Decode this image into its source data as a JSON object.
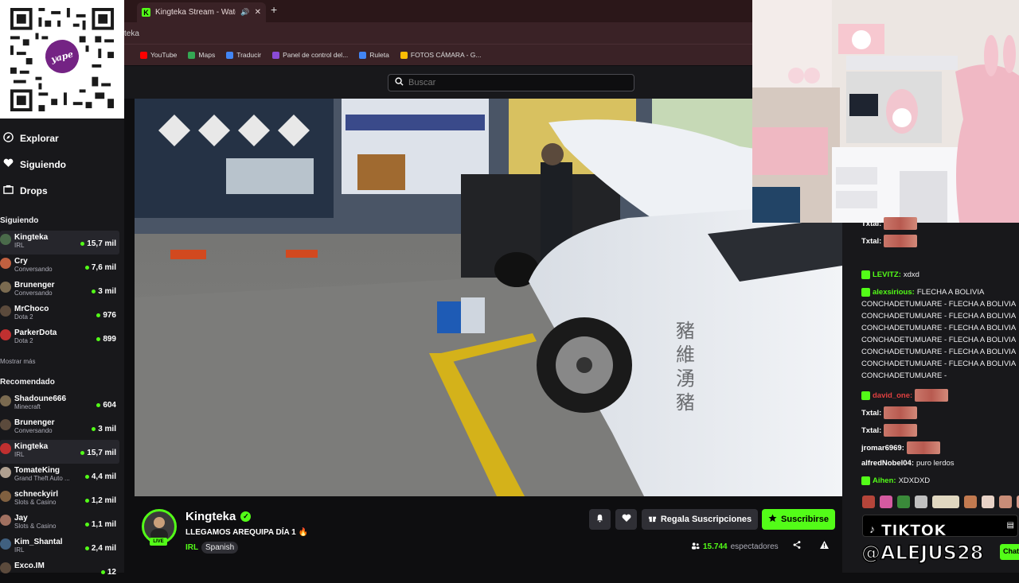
{
  "browser": {
    "tab_title": "Kingteka Stream - Watch Li",
    "tab_favicon": "K",
    "address_text": "teka",
    "bookmarks": [
      {
        "label": "YouTube",
        "icon": "youtube-icon",
        "color": "#ff0000"
      },
      {
        "label": "Maps",
        "icon": "maps-icon",
        "color": "#34a853"
      },
      {
        "label": "Traducir",
        "icon": "translate-icon",
        "color": "#4285f4"
      },
      {
        "label": "Panel de control del...",
        "icon": "panel-icon",
        "color": "#8a4bd6"
      },
      {
        "label": "Ruleta",
        "icon": "ruleta-icon",
        "color": "#4285f4"
      },
      {
        "label": "FOTOS CÁMARA - G...",
        "icon": "drive-icon",
        "color": "#fbbc04"
      }
    ]
  },
  "qr": {
    "brand": "yape"
  },
  "search": {
    "placeholder": "Buscar"
  },
  "sidebar": {
    "nav": [
      {
        "label": "Explorar",
        "icon": "compass-icon"
      },
      {
        "label": "Siguiendo",
        "icon": "heart-icon"
      },
      {
        "label": "Drops",
        "icon": "drops-icon"
      }
    ],
    "following_title": "Siguiendo",
    "following": [
      {
        "name": "Kingteka",
        "category": "IRL",
        "viewers": "15,7 mil",
        "active": true
      },
      {
        "name": "Cry",
        "category": "Conversando",
        "viewers": "7,6 mil"
      },
      {
        "name": "Brunenger",
        "category": "Conversando",
        "viewers": "3 mil"
      },
      {
        "name": "MrChoco",
        "category": "Dota 2",
        "viewers": "976"
      },
      {
        "name": "ParkerDota",
        "category": "Dota 2",
        "viewers": "899"
      }
    ],
    "show_more": "Mostrar más",
    "recommended_title": "Recomendado",
    "recommended": [
      {
        "name": "Shadoune666",
        "category": "Minecraft",
        "viewers": "604"
      },
      {
        "name": "Brunenger",
        "category": "Conversando",
        "viewers": "3 mil"
      },
      {
        "name": "Kingteka",
        "category": "IRL",
        "viewers": "15,7 mil",
        "active": true
      },
      {
        "name": "TomateKing",
        "category": "Grand Theft Auto ...",
        "viewers": "4,4 mil"
      },
      {
        "name": "schneckyirl",
        "category": "Slots & Casino",
        "viewers": "1,2 mil"
      },
      {
        "name": "Jay",
        "category": "Slots & Casino",
        "viewers": "1,1 mil"
      },
      {
        "name": "Kim_Shantal",
        "category": "IRL",
        "viewers": "2,4 mil"
      },
      {
        "name": "Exco.IM",
        "category": "",
        "viewers": "12"
      }
    ]
  },
  "stream": {
    "streamer": "Kingteka",
    "title": "LLEGAMOS AREQUIPA DÍA 1 🔥",
    "live_badge": "LIVE",
    "category": "IRL",
    "language": "Spanish",
    "gift_label": "Regala Suscripciones",
    "subscribe_label": "Suscribirse",
    "viewers_count": "15.744",
    "viewers_label": "espectadores"
  },
  "chat": {
    "messages": [
      {
        "user": "Txtal:",
        "color": "#ffffff",
        "text": "",
        "emote": true
      },
      {
        "user": "Txtal:",
        "color": "#ffffff",
        "text": "",
        "emote": true
      },
      {
        "user": "LEVITZ:",
        "color": "#53fc18",
        "text": "xdxd",
        "badge": "60"
      },
      {
        "user": "alexsirious:",
        "color": "#53fc18",
        "text": "FLECHA A BOLIVIA",
        "badge": "sub"
      },
      {
        "user": "",
        "text": "CONCHADETUMUARE - FLECHA A BOLIVIA"
      },
      {
        "user": "",
        "text": "CONCHADETUMUARE - FLECHA A BOLIVIA"
      },
      {
        "user": "",
        "text": "CONCHADETUMUARE - FLECHA A BOLIVIA"
      },
      {
        "user": "",
        "text": "CONCHADETUMUARE - FLECHA A BOLIVIA"
      },
      {
        "user": "",
        "text": "CONCHADETUMUARE - FLECHA A BOLIVIA"
      },
      {
        "user": "",
        "text": "CONCHADETUMUARE - FLECHA A BOLIVIA"
      },
      {
        "user": "",
        "text": "CONCHADETUMUARE -"
      },
      {
        "user": "david_one:",
        "color": "#e04040",
        "text": "",
        "emote": true,
        "badge": "22"
      },
      {
        "user": "Txtal:",
        "color": "#ffffff",
        "text": "",
        "emote": true
      },
      {
        "user": "Txtal:",
        "color": "#ffffff",
        "text": "",
        "emote": true
      },
      {
        "user": "jromar6969:",
        "color": "#ffffff",
        "text": "",
        "emote": true
      },
      {
        "user": "alfredNobel04:",
        "color": "#ffffff",
        "text": "puro lerdos"
      },
      {
        "user": "Aihen:",
        "color": "#53fc18",
        "text": "XDXDXD",
        "badge": "sub"
      }
    ],
    "overlay_tiktok": "TIKTOK",
    "overlay_handle": "@ALEJUS28",
    "chat_button": "Chat"
  }
}
